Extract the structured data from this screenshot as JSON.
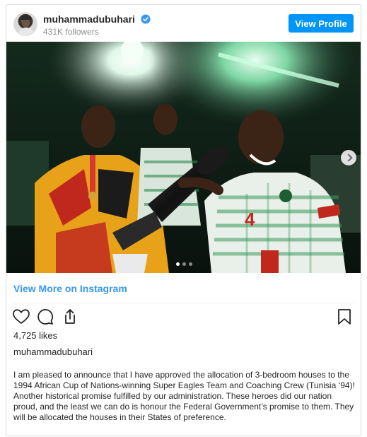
{
  "header": {
    "username": "muhammadubuhari",
    "followers": "431K followers",
    "view_profile_label": "View Profile"
  },
  "post": {
    "image_icon": "photo-of-footballers-with-trophy",
    "carousel": {
      "slide_count": 3,
      "active_slide": 1
    }
  },
  "view_more_label": "View More on Instagram",
  "actions": {
    "icons": [
      "heart-icon",
      "comment-icon",
      "share-icon",
      "bookmark-icon"
    ]
  },
  "likes": "4,725 likes",
  "owner": "muhammadubuhari",
  "caption": "I am pleased to announce that I have approved the allocation of 3-bedroom houses to the 1994 African Cup of Nations-winning Super Eagles Team and Coaching Crew (Tunisia ‘94)! Another historical promise fulfilled by our administration. These heroes did our nation proud, and the least we can do is honour the Federal Government’s promise to them. They will be allocated the houses in their States of preference.",
  "colors": {
    "accent": "#0095f6",
    "link": "#3897f0",
    "verified": "#3897f0",
    "text": "#262626",
    "muted": "#8e8e8e"
  }
}
